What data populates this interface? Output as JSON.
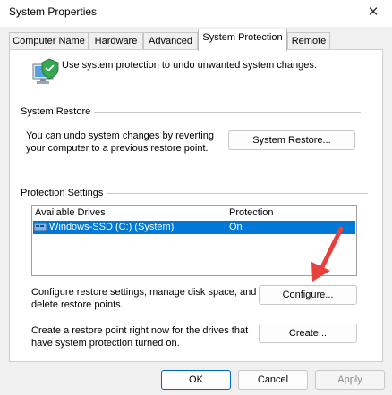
{
  "window": {
    "title": "System Properties",
    "close_glyph": "✕"
  },
  "tabs": [
    {
      "label": "Computer Name"
    },
    {
      "label": "Hardware"
    },
    {
      "label": "Advanced"
    },
    {
      "label": "System Protection",
      "active": true
    },
    {
      "label": "Remote"
    }
  ],
  "intro": "Use system protection to undo unwanted system changes.",
  "system_restore": {
    "group_label": "System Restore",
    "description_line1": "You can undo system changes by reverting",
    "description_line2": "your computer to a previous restore point.",
    "button_label": "System Restore..."
  },
  "protection_settings": {
    "group_label": "Protection Settings",
    "columns": {
      "drives": "Available Drives",
      "protection": "Protection"
    },
    "rows": [
      {
        "drive": "Windows-SSD (C:) (System)",
        "protection": "On",
        "selected": true
      }
    ],
    "configure": {
      "line1": "Configure restore settings, manage disk space, and",
      "line2": "delete restore points.",
      "button_label": "Configure..."
    },
    "create": {
      "line1": "Create a restore point right now for the drives that",
      "line2": "have system protection turned on.",
      "button_label": "Create..."
    }
  },
  "footer": {
    "ok": "OK",
    "cancel": "Cancel",
    "apply": "Apply"
  },
  "colors": {
    "selection": "#0078d7",
    "annotation_arrow": "#e8403c"
  },
  "icons": [
    "computer-shield-icon",
    "drive-icon",
    "close-icon"
  ]
}
